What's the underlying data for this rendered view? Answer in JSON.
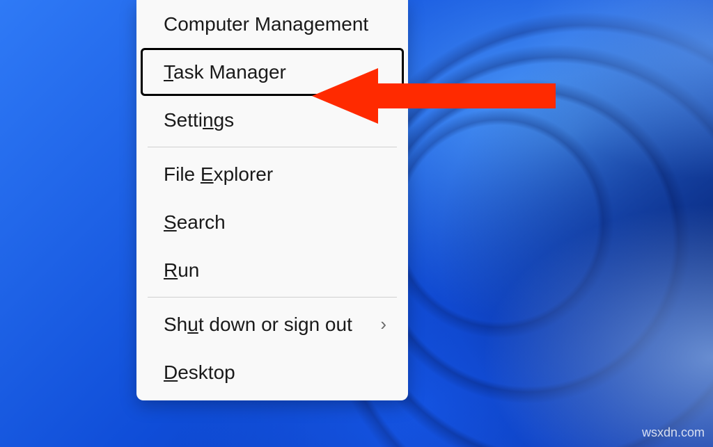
{
  "menu": {
    "items": [
      {
        "id": "computer-management",
        "pre": "Computer Mana",
        "u": "g",
        "post": "ement",
        "submenu": false,
        "highlight": false
      },
      {
        "id": "task-manager",
        "pre": "",
        "u": "T",
        "post": "ask Manager",
        "submenu": false,
        "highlight": true
      },
      {
        "id": "settings",
        "pre": "Setti",
        "u": "n",
        "post": "gs",
        "submenu": false,
        "highlight": false
      },
      {
        "separator": true
      },
      {
        "id": "file-explorer",
        "pre": "File ",
        "u": "E",
        "post": "xplorer",
        "submenu": false,
        "highlight": false
      },
      {
        "id": "search",
        "pre": "",
        "u": "S",
        "post": "earch",
        "submenu": false,
        "highlight": false
      },
      {
        "id": "run",
        "pre": "",
        "u": "R",
        "post": "un",
        "submenu": false,
        "highlight": false
      },
      {
        "separator": true
      },
      {
        "id": "shut-down",
        "pre": "Sh",
        "u": "u",
        "post": "t down or sign out",
        "submenu": true,
        "highlight": false
      },
      {
        "id": "desktop",
        "pre": "",
        "u": "D",
        "post": "esktop",
        "submenu": false,
        "highlight": false
      }
    ],
    "chevron_glyph": "›"
  },
  "arrow": {
    "color": "#ff2a00"
  },
  "watermark": "wsxdn.com"
}
